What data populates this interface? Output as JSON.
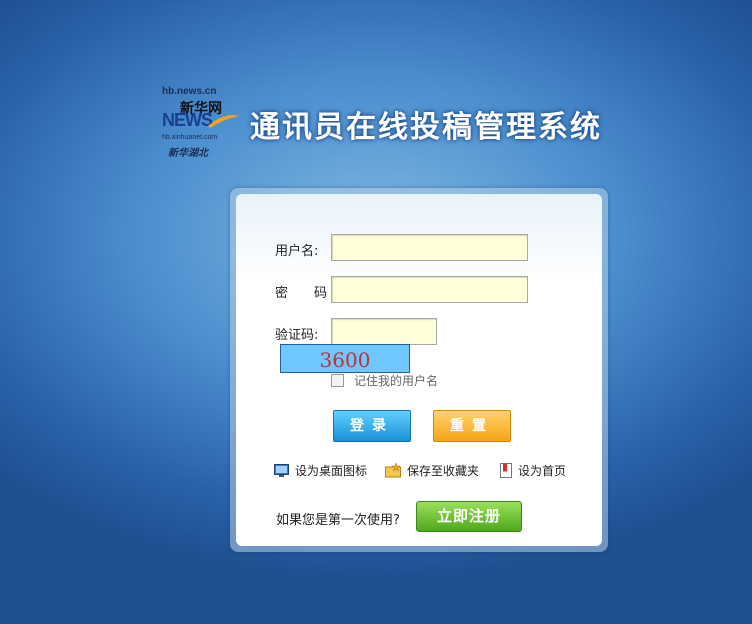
{
  "logo": {
    "url_top": "hb.news.cn",
    "brand": "新华网",
    "news": "NEWS",
    "url_bottom": "hb.xinhuanet.com",
    "region": "新华湖北"
  },
  "title": "通讯员在线投稿管理系统",
  "form": {
    "username_label": "用户名:",
    "username_value": "",
    "password_label": "密　　码",
    "password_value": "",
    "captcha_label": "验证码:",
    "captcha_value": "",
    "captcha_image_text": "3600",
    "remember_label": "记住我的用户名",
    "remember_checked": false
  },
  "buttons": {
    "login": "登录",
    "reset": "重置"
  },
  "links": {
    "desktop_icon": "设为桌面图标",
    "favorites": "保存至收藏夹",
    "homepage": "设为首页"
  },
  "register": {
    "question": "如果您是第一次使用?",
    "button": "立即注册"
  },
  "colors": {
    "login_button": "#1a90d6",
    "reset_button": "#f5a316",
    "register_button": "#4ea81c",
    "input_bg": "#ffffd9",
    "captcha_bg": "#6ec7ff",
    "captcha_text": "#c23030"
  }
}
